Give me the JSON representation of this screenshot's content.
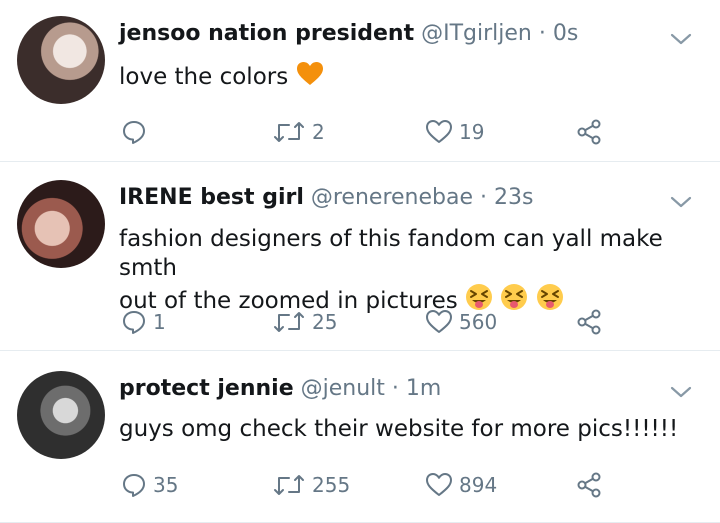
{
  "tweets": [
    {
      "name": "jensoo nation president",
      "handle": "@ITgirljen",
      "separator": "·",
      "time": "0s",
      "text": "love the colors",
      "emojis": [
        "orange-heart"
      ],
      "reply_count": "",
      "retweet_count": "2",
      "like_count": "19"
    },
    {
      "name": "IRENE best girl",
      "handle": "@renerenebae",
      "separator": "·",
      "time": "23s",
      "text_line1": "fashion designers of this fandom can yall make smth",
      "text_line2": "out of the zoomed in pictures",
      "emojis": [
        "squinting-tongue",
        "squinting-tongue",
        "squinting-tongue"
      ],
      "reply_count": "1",
      "retweet_count": "25",
      "like_count": "560"
    },
    {
      "name": "protect jennie",
      "handle": "@jenult",
      "separator": "·",
      "time": "1m",
      "text": "guys omg check their website for more pics!!!!!!",
      "emojis": [],
      "reply_count": "35",
      "retweet_count": "255",
      "like_count": "894"
    }
  ],
  "colors": {
    "text": "#14171a",
    "secondary": "#657786",
    "divider": "#e6ecf0",
    "orange_heart": "#f4900c",
    "emoji_yellow": "#ffcc4d"
  }
}
